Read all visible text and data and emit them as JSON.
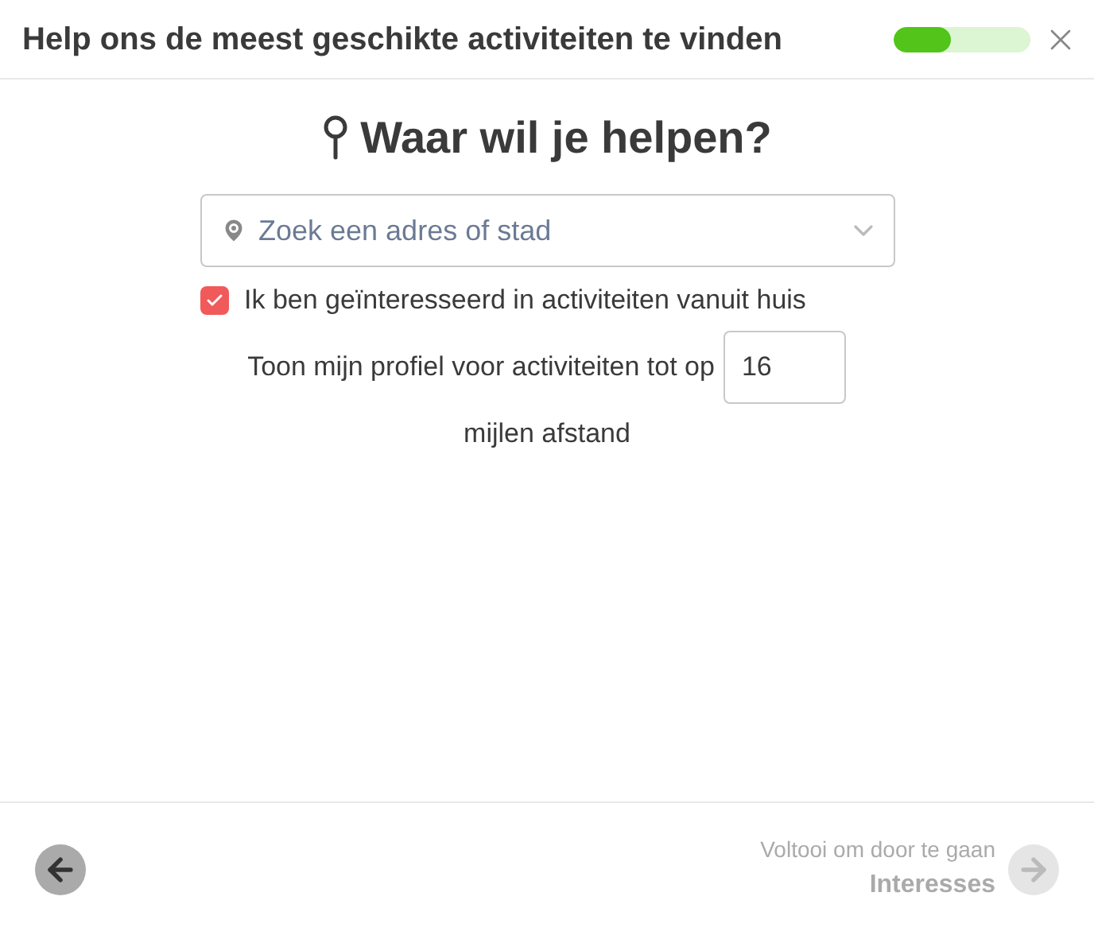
{
  "header": {
    "title": "Help ons de meest geschikte activiteiten te vinden",
    "progress": {
      "level": 0.42
    }
  },
  "heading": "Waar wil je helpen?",
  "location": {
    "placeholder": "Zoek een adres of stad"
  },
  "home_checkbox": {
    "label": "Ik ben geïnteresseerd in activiteiten vanuit huis",
    "checked": true
  },
  "distance": {
    "label_before": "Toon mijn profiel voor activiteiten tot op",
    "value": "16",
    "label_after": "mijlen afstand"
  },
  "footer": {
    "hint": "Voltooi om door te gaan",
    "next_label": "Interesses",
    "next_disabled": true
  }
}
